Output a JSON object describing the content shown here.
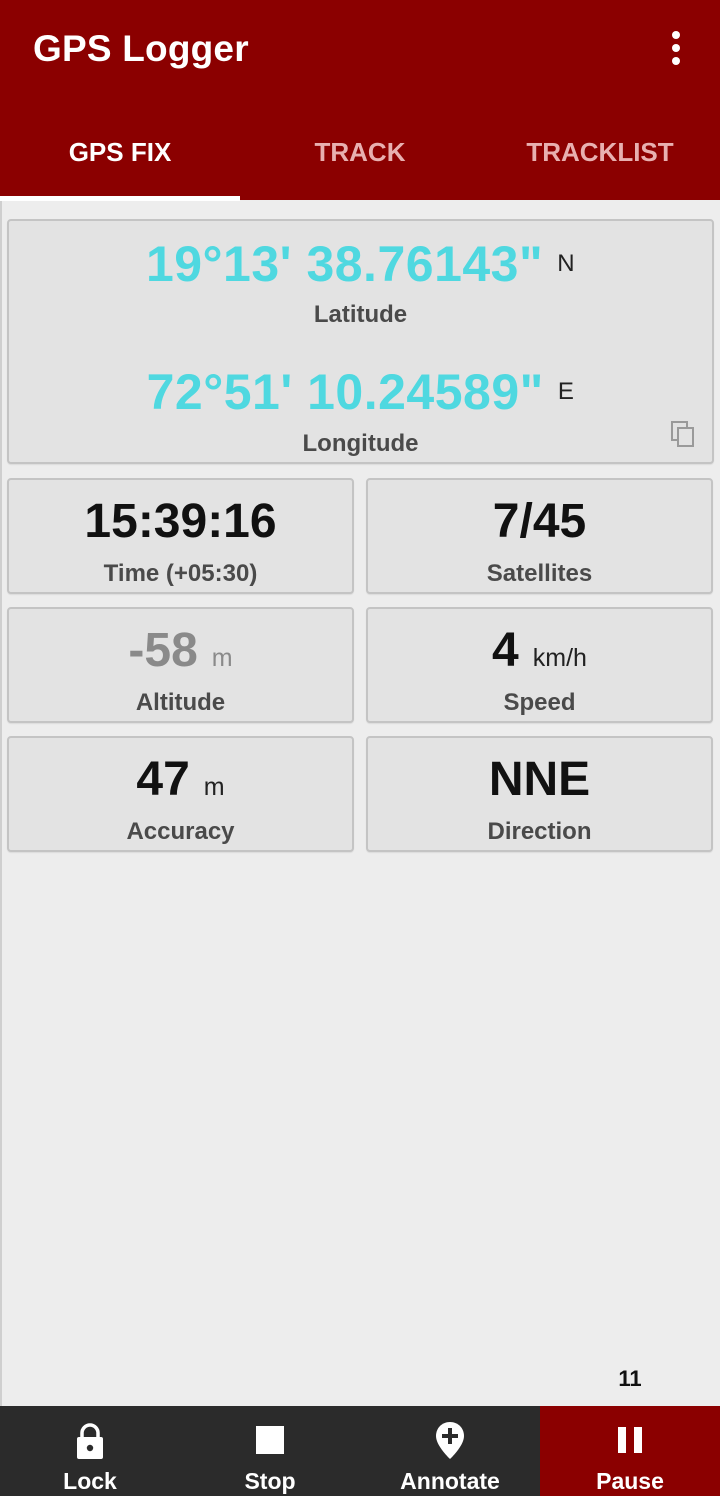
{
  "app": {
    "title": "GPS Logger"
  },
  "tabs": [
    {
      "label": "GPS FIX"
    },
    {
      "label": "TRACK"
    },
    {
      "label": "TRACKLIST"
    }
  ],
  "gps_fix": {
    "latitude": {
      "value": "19°13' 38.76143\"",
      "hemisphere": "N",
      "label": "Latitude"
    },
    "longitude": {
      "value": "72°51' 10.24589\"",
      "hemisphere": "E",
      "label": "Longitude"
    },
    "time": {
      "value": "15:39:16",
      "label": "Time (+05:30)"
    },
    "satellites": {
      "value": "7/45",
      "label": "Satellites"
    },
    "altitude": {
      "value": "-58",
      "unit": "m",
      "label": "Altitude"
    },
    "speed": {
      "value": "4",
      "unit": "km/h",
      "label": "Speed"
    },
    "accuracy": {
      "value": "47",
      "unit": "m",
      "label": "Accuracy"
    },
    "direction": {
      "value": "NNE",
      "label": "Direction"
    }
  },
  "counter": "11",
  "bottom_bar": {
    "lock_label": "Lock",
    "stop_label": "Stop",
    "annotate_label": "Annotate",
    "pause_label": "Pause"
  },
  "icons": {
    "overflow": "more-vert-icon",
    "copy": "copy-icon",
    "lock": "lock-icon",
    "stop": "stop-icon",
    "annotate": "add-location-icon",
    "pause": "pause-icon"
  },
  "colors": {
    "primary": "#8b0000",
    "coordinate_text": "#4fd8e0",
    "bottom_bar": "#2b2b2b",
    "background": "#ededed"
  }
}
